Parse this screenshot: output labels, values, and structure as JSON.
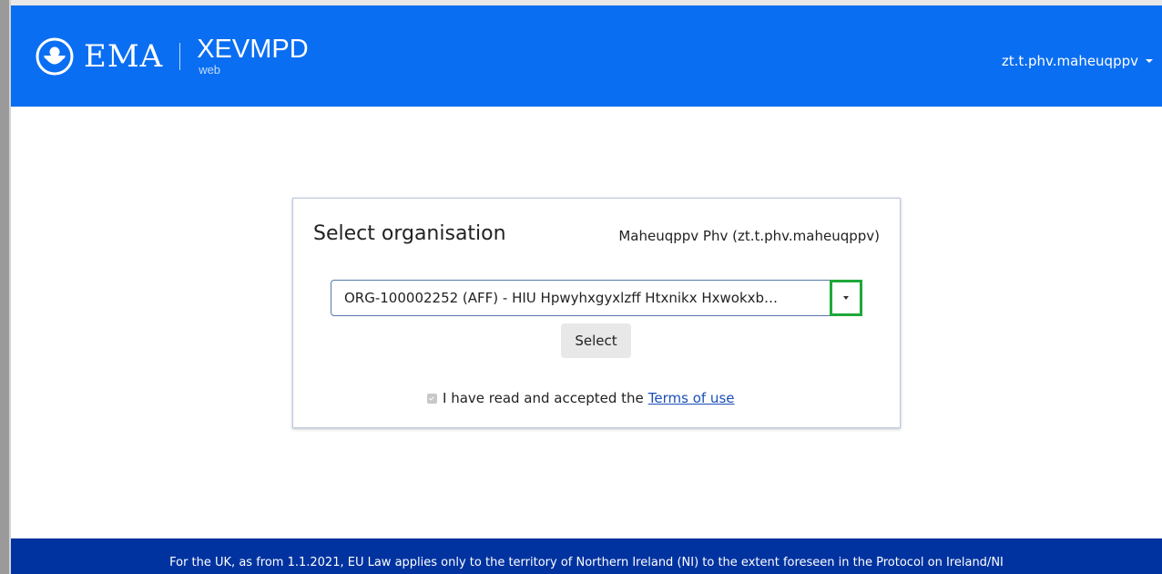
{
  "header": {
    "brand": "EMA",
    "app_name": "XEVMPD",
    "app_sub": "web",
    "user_menu_label": "zt.t.phv.maheuqppv",
    "background_color": "#0a6ef2"
  },
  "card": {
    "title": "Select organisation",
    "user_display": "Maheuqppv Phv (zt.t.phv.maheuqppv)",
    "org_select_value": "ORG-100002252 (AFF) - HIU Hpwyhxgyxlzff Htxnikx Hxwokxb…",
    "select_button_label": "Select",
    "terms_prefix": "I have read and accepted the",
    "terms_link": "Terms of use",
    "terms_checked": true
  },
  "footer": {
    "text": "For the UK, as from 1.1.2021, EU Law applies only to the territory of Northern Ireland (NI) to the extent foreseen in the Protocol on Ireland/NI",
    "background_color": "#0033a0"
  },
  "icons": {
    "logo": "ema-logo-icon",
    "user_caret": "caret-down-icon",
    "select_caret": "chevron-down-icon",
    "checkbox": "checkbox-checked-icon"
  },
  "highlight_color": "#1fa83a"
}
